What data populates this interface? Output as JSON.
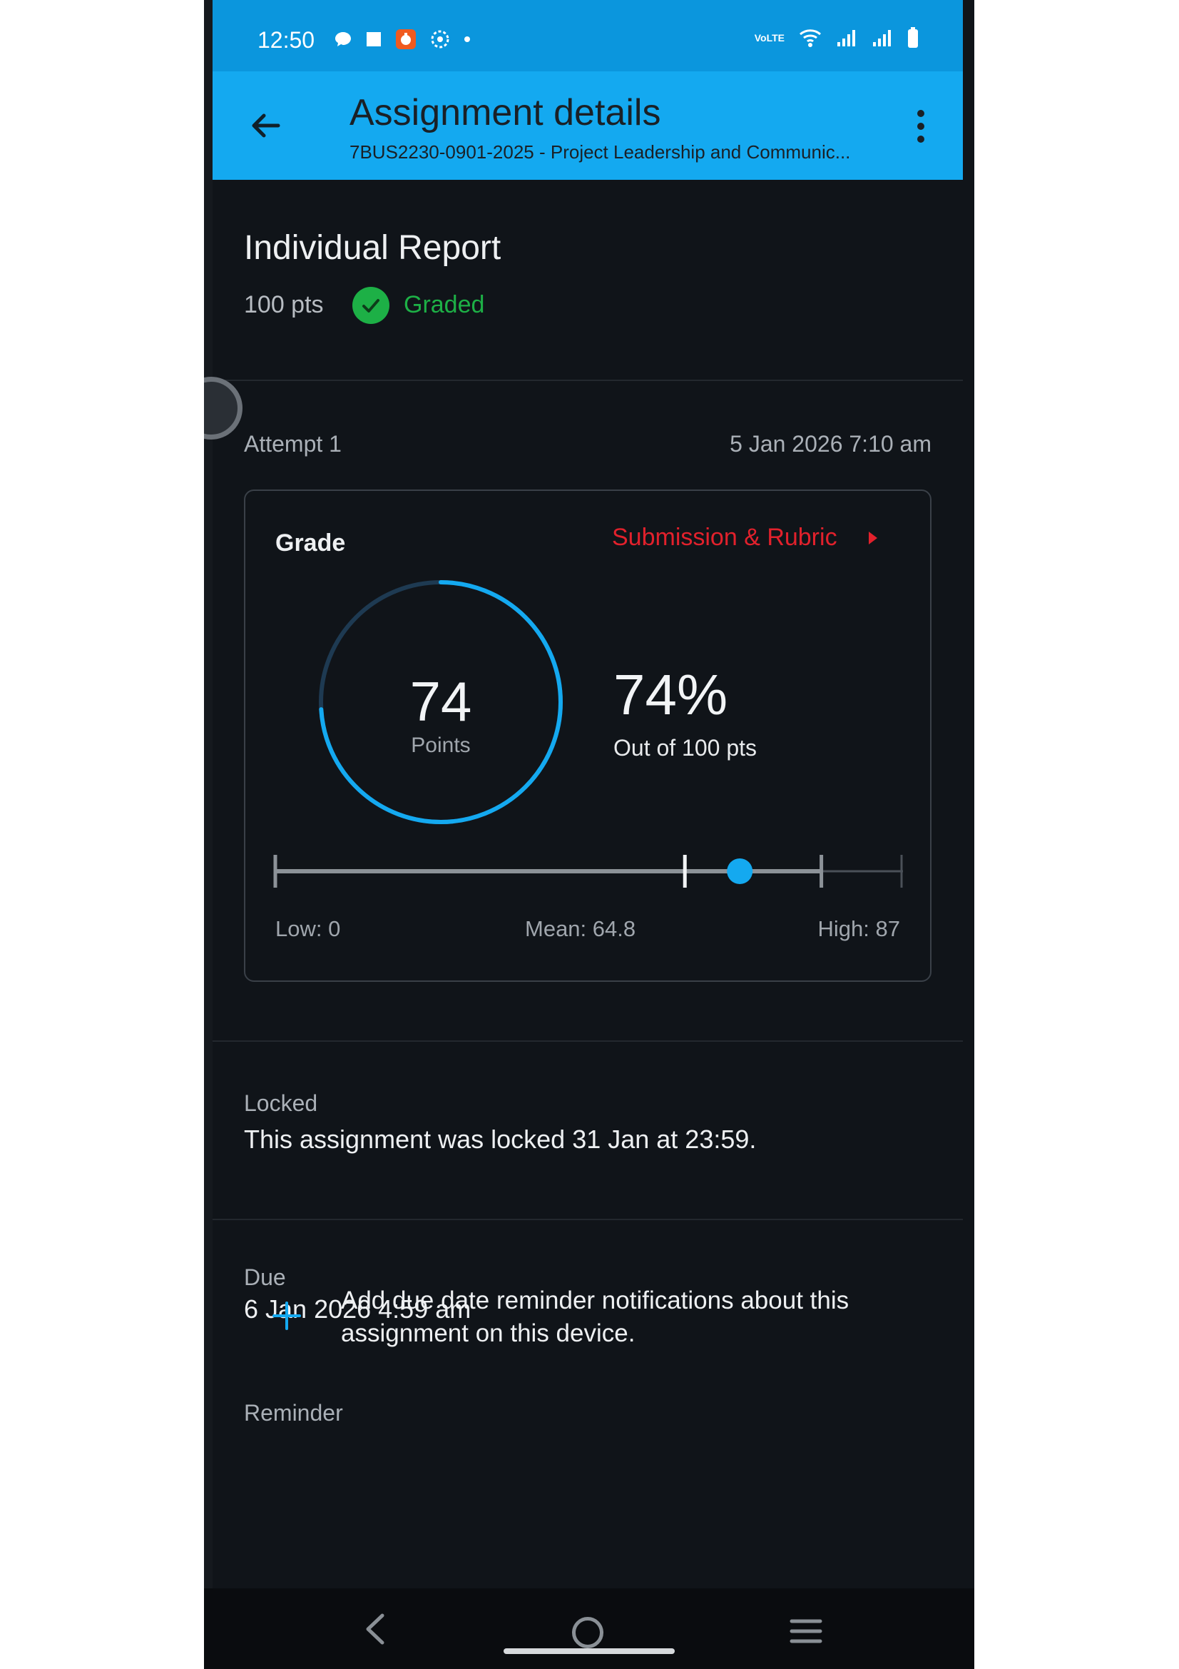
{
  "status_bar": {
    "time": "12:50",
    "network_label": "VoLTE"
  },
  "app_bar": {
    "title": "Assignment details",
    "subtitle": "7BUS2230-0901-2025 - Project Leadership and Communic..."
  },
  "assignment": {
    "title": "Individual Report",
    "points_possible": "100 pts",
    "status": "Graded"
  },
  "attempt": {
    "label": "Attempt 1",
    "date": "5 Jan 2026 7:10 am"
  },
  "grade": {
    "label": "Grade",
    "link_label": "Submission & Rubric",
    "points_value": "74",
    "points_label": "Points",
    "percent": "74%",
    "out_of": "Out of 100 pts",
    "score_fraction": 0.74,
    "stats": {
      "low_label": "Low: 0",
      "mean_label": "Mean: 64.8",
      "high_label": "High: 87",
      "low": 0,
      "mean": 64.8,
      "high": 87,
      "score": 74,
      "max": 100
    },
    "colors": {
      "accent": "#14a9f0",
      "link": "#e2212c",
      "graded": "#1db046"
    }
  },
  "locked": {
    "label": "Locked",
    "text": "This assignment was locked 31 Jan at 23:59."
  },
  "due": {
    "label": "Due",
    "value": "6 Jan 2026 4:59 am"
  },
  "reminder": {
    "label": "Reminder",
    "text": "Add due date reminder notifications about this assignment on this device."
  }
}
